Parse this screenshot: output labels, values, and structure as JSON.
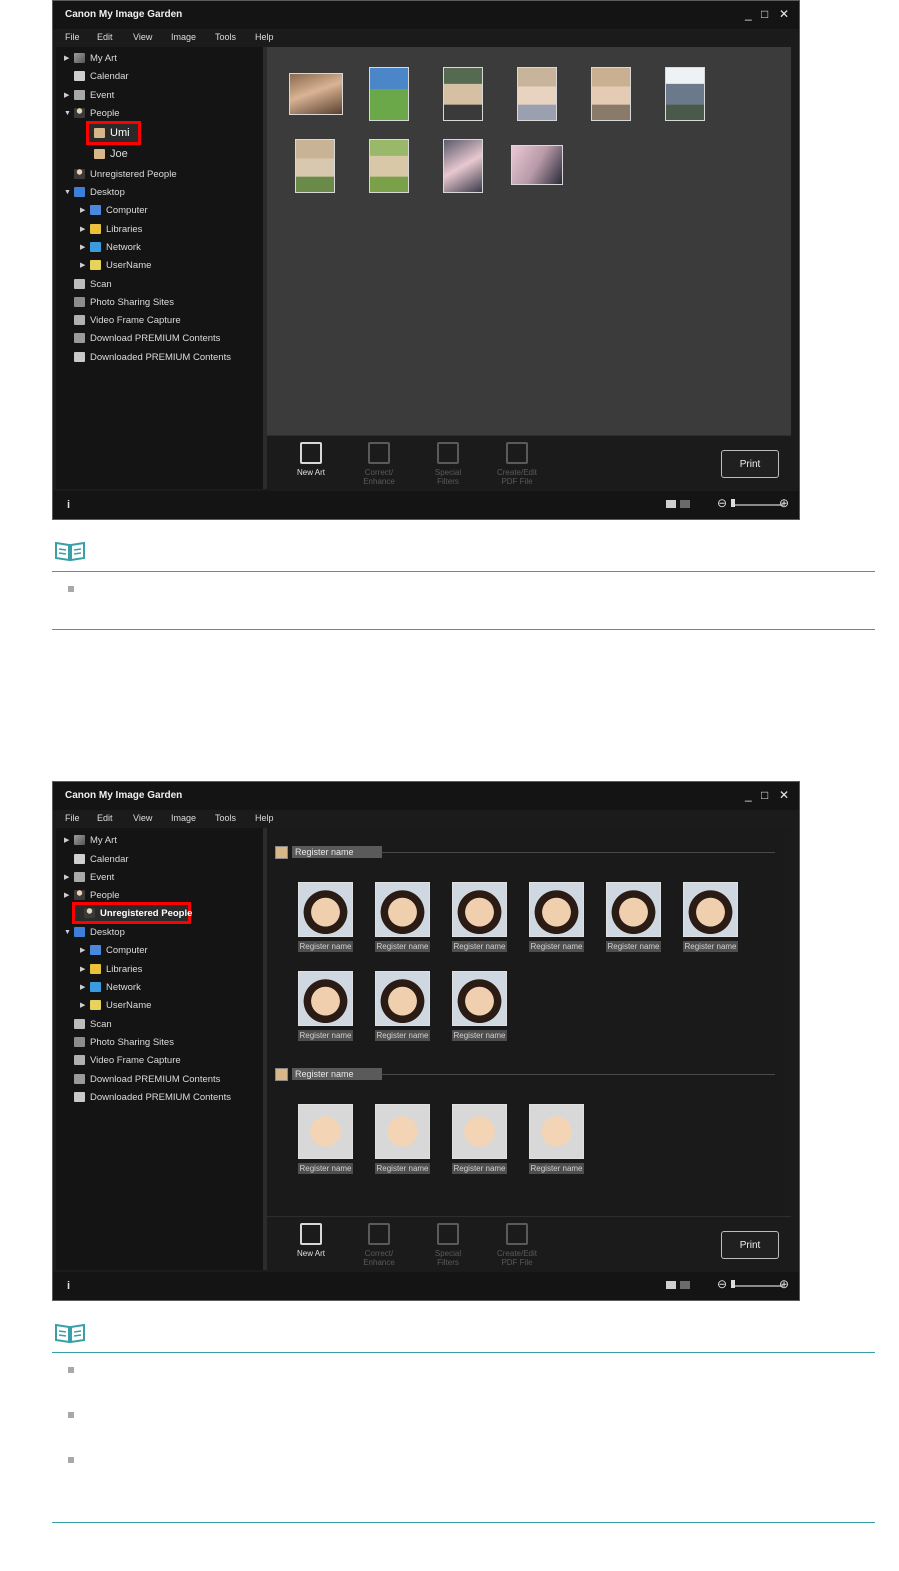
{
  "app": {
    "title": "Canon My Image Garden",
    "minimize": "_",
    "maximize": "□",
    "close": "✕"
  },
  "menu": [
    "File",
    "Edit",
    "View",
    "Image",
    "Tools",
    "Help"
  ],
  "sidebar": {
    "my_art": "My Art",
    "calendar": "Calendar",
    "event": "Event",
    "people": "People",
    "umi": "Umi",
    "joe": "Joe",
    "unregistered_people": "Unregistered People",
    "desktop": "Desktop",
    "computer": "Computer",
    "libraries": "Libraries",
    "network": "Network",
    "username": "UserName",
    "scan": "Scan",
    "photo_sharing": "Photo Sharing Sites",
    "video_capture": "Video Frame Capture",
    "download_premium": "Download PREMIUM Contents",
    "downloaded_premium": "Downloaded PREMIUM Contents"
  },
  "toolbar": {
    "new_art": "New Art",
    "correct_enhance_1": "Correct/",
    "correct_enhance_2": "Enhance",
    "special_filters_1": "Special",
    "special_filters_2": "Filters",
    "create_pdf_1": "Create/Edit",
    "create_pdf_2": "PDF File",
    "print": "Print"
  },
  "status": {
    "info": "i",
    "zoom_minus": "⊖",
    "zoom_plus": "⊕"
  },
  "unregistered": {
    "register_name": "Register name"
  },
  "colors": {
    "window_bg": "#1b1b1b",
    "content_bg": "#3b3b3b",
    "highlight": "#ff0000",
    "note_line": "#3aa0a8"
  }
}
